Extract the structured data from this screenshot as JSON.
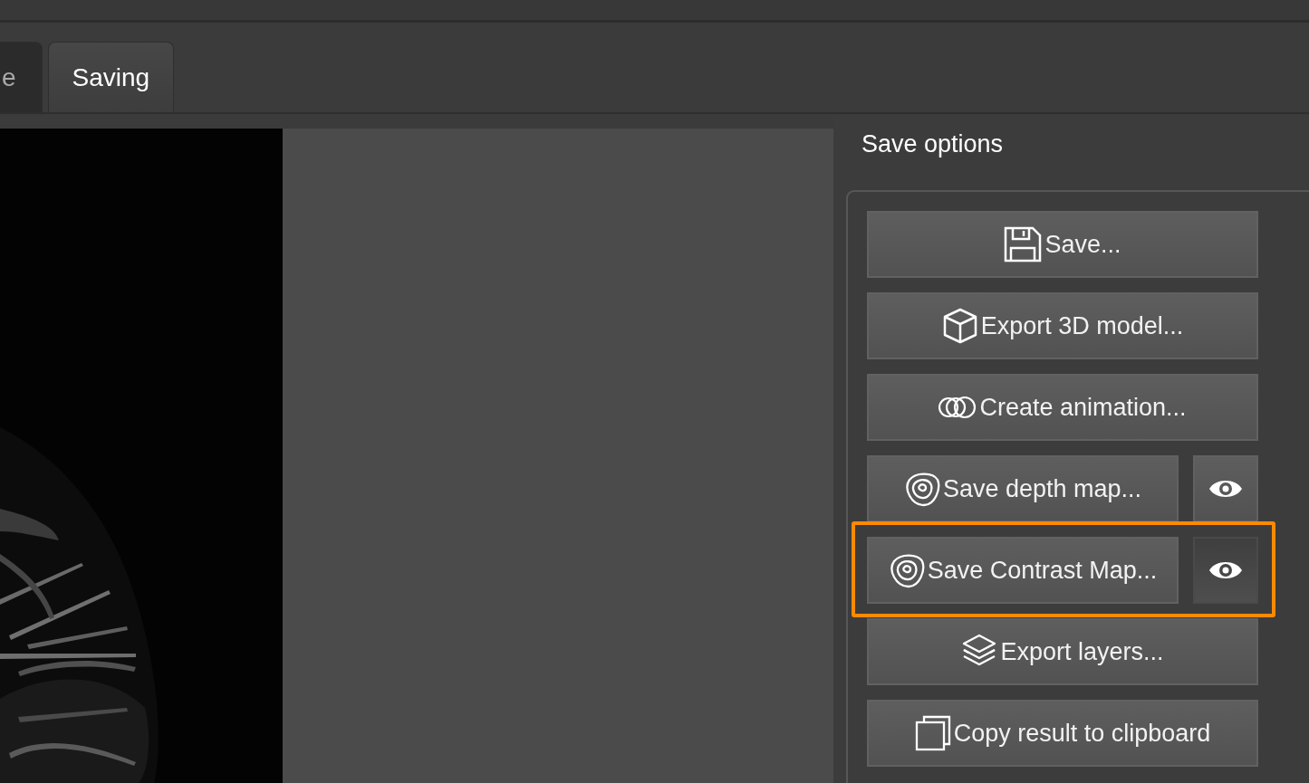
{
  "tabs": [
    {
      "label": "e",
      "selected": false
    },
    {
      "label": "Saving",
      "selected": true
    }
  ],
  "save_options": {
    "title": "Save options",
    "buttons": [
      {
        "label": "Save...",
        "highlighted": false
      },
      {
        "label": "Export 3D model...",
        "highlighted": false
      },
      {
        "label": "Create animation...",
        "highlighted": false
      },
      {
        "label": "Save depth map...",
        "highlighted": false,
        "preview": {
          "selected": false
        }
      },
      {
        "label": "Save Contrast Map...",
        "highlighted": true,
        "preview": {
          "selected": true
        }
      },
      {
        "label": "Export layers...",
        "highlighted": false
      },
      {
        "label": "Copy result to clipboard",
        "highlighted": false
      }
    ]
  }
}
